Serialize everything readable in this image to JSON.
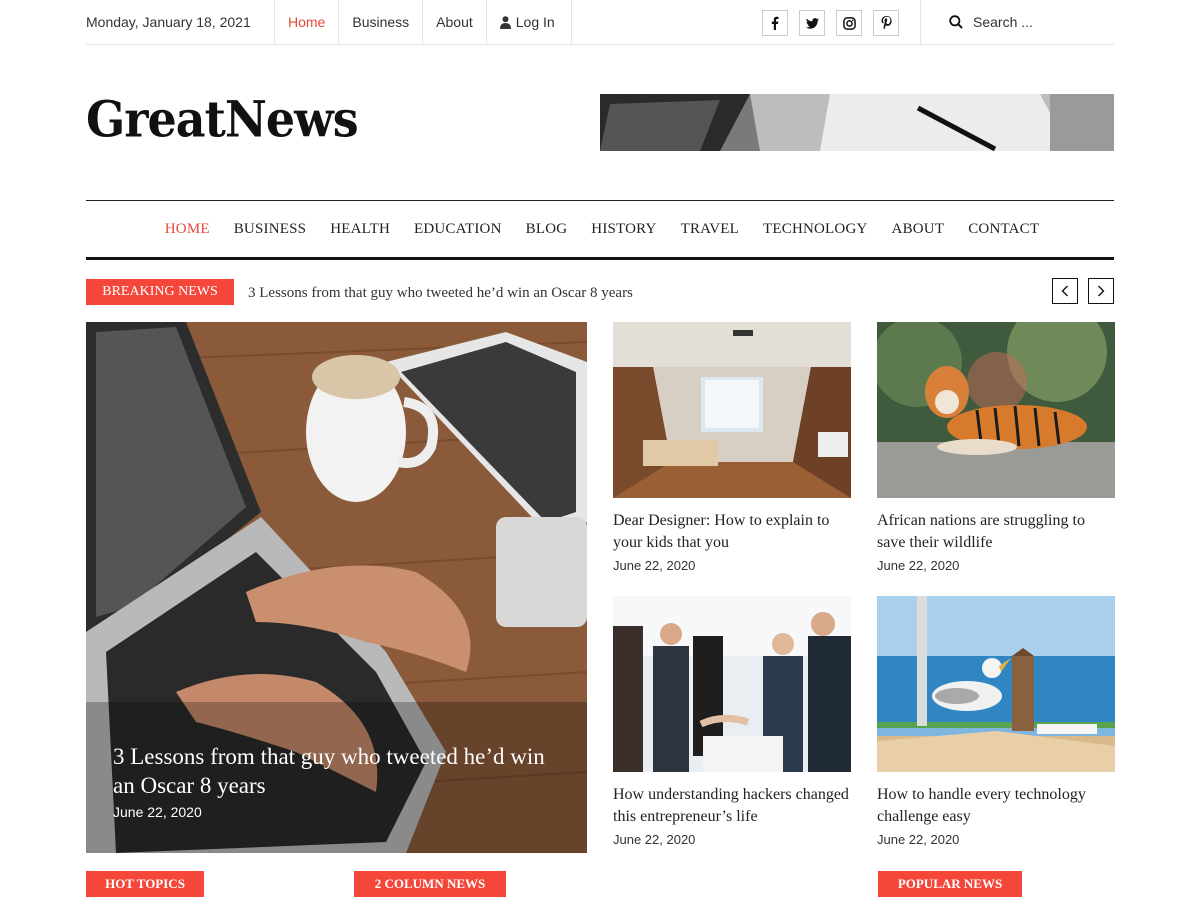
{
  "topbar": {
    "date": "Monday, January 18, 2021",
    "nav": [
      {
        "label": "Home",
        "active": true
      },
      {
        "label": "Business"
      },
      {
        "label": "About"
      },
      {
        "label": "Log In",
        "icon": "user-icon"
      }
    ],
    "social": [
      "facebook-icon",
      "twitter-icon",
      "instagram-icon",
      "pinterest-icon"
    ],
    "search_label": "Search ..."
  },
  "logo": "GreatNews",
  "mainnav": [
    "HOME",
    "BUSINESS",
    "HEALTH",
    "EDUCATION",
    "BLOG",
    "HISTORY",
    "TRAVEL",
    "TECHNOLOGY",
    "ABOUT",
    "CONTACT"
  ],
  "breaking": {
    "label": "BREAKING NEWS",
    "headline": "3 Lessons from that guy who tweeted he’d win an Oscar 8 years"
  },
  "hero": {
    "title": "3 Lessons from that guy who tweeted he’d win an Oscar 8 years",
    "date": "June 22, 2020"
  },
  "cards": [
    {
      "title": "Dear Designer: How to explain to your kids that you",
      "date": "June 22, 2020"
    },
    {
      "title": "African nations are struggling to save their wildlife",
      "date": "June 22, 2020"
    },
    {
      "title": "How understanding hackers changed this entrepreneur’s life",
      "date": "June 22, 2020"
    },
    {
      "title": "How to handle every technology challenge easy",
      "date": "June 22, 2020"
    }
  ],
  "sections": [
    "HOT TOPICS",
    "2 COLUMN NEWS",
    "POPULAR NEWS"
  ],
  "colors": {
    "accent": "#f4473a",
    "text": "#222222"
  }
}
